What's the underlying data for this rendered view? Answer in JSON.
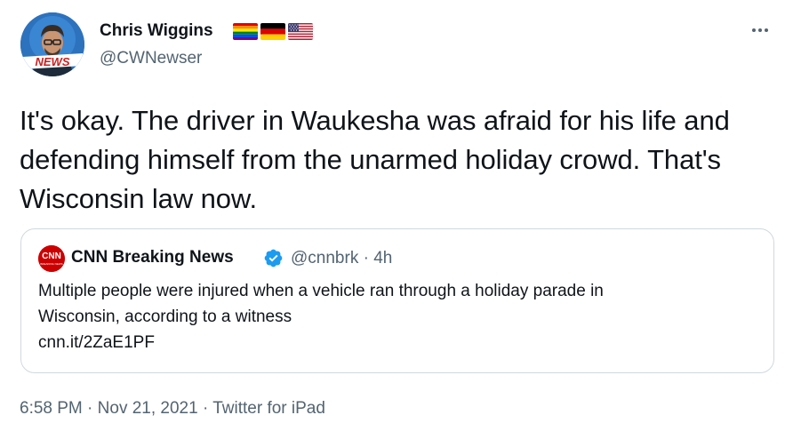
{
  "tweet": {
    "author": {
      "display_name": "Chris Wiggins",
      "handle": "@CWNewser",
      "avatar_badge": "NEWS",
      "flags": [
        "rainbow-flag",
        "germany-flag",
        "usa-flag"
      ]
    },
    "more_menu_icon": "more-horizontal-icon",
    "text": "It's okay. The driver in Waukesha was afraid for his life and defending himself from the unarmed holiday crowd. That's Wisconsin law now.",
    "quoted": {
      "logo_text": "CNN",
      "logo_subtext": "BREAKING NEWS",
      "display_name": "CNN Breaking News",
      "verified": true,
      "handle_time": "@cnnbrk · 4h",
      "text_line1": "Multiple people were injured when a vehicle ran through a holiday parade in",
      "text_line2": "Wisconsin, according to a witness",
      "link": "cnn.it/2ZaE1PF"
    },
    "meta": {
      "time": "6:58 PM",
      "sep1": " · ",
      "date": "Nov 21, 2021",
      "sep2": " · ",
      "source": "Twitter for iPad"
    }
  },
  "colors": {
    "text": "#0f1419",
    "secondary": "#536471",
    "border": "#cfd9de",
    "verified": "#1d9bf0",
    "cnn_red": "#cc0000"
  }
}
